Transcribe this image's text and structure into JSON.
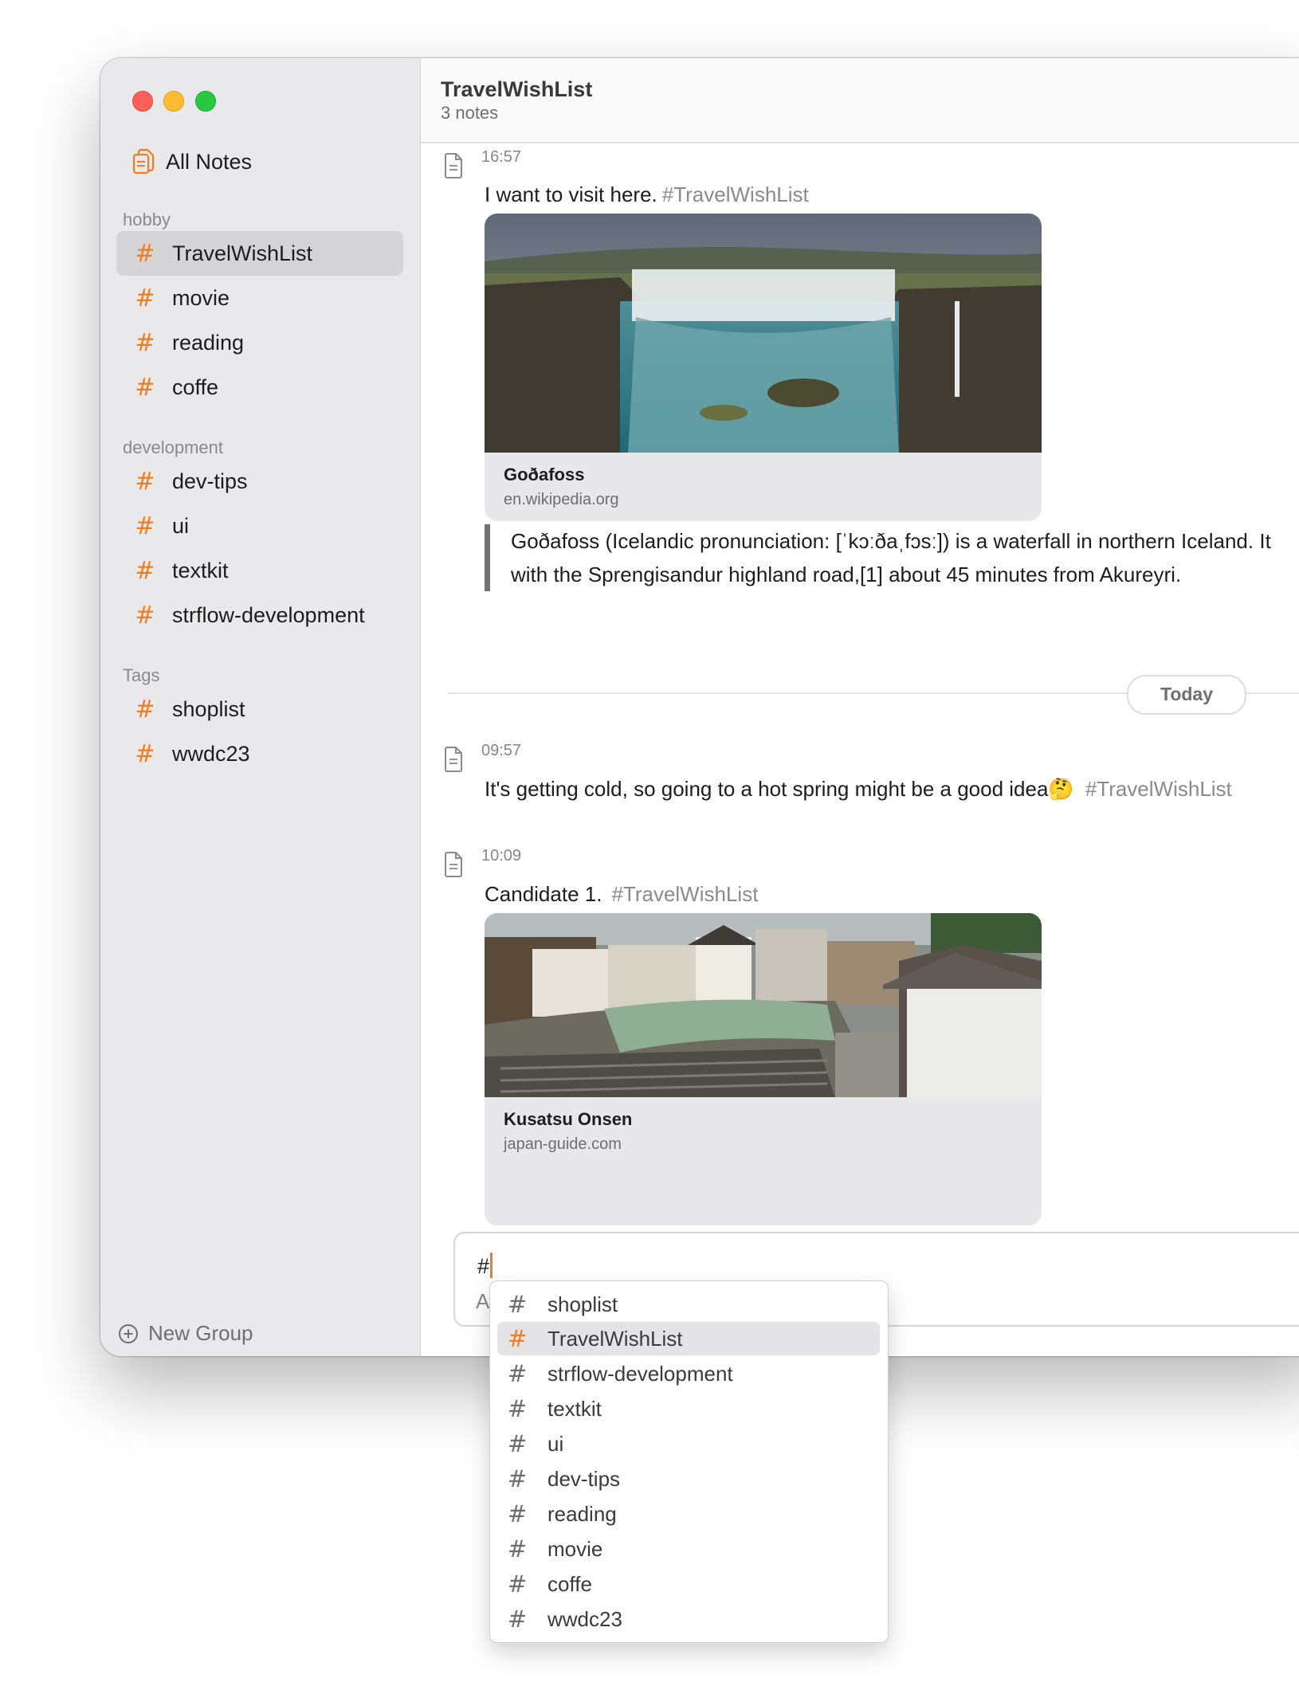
{
  "window": {
    "traffic_lights": [
      "close",
      "minimize",
      "zoom"
    ]
  },
  "sidebar": {
    "all_notes_label": "All Notes",
    "groups": [
      {
        "label": "hobby",
        "items": [
          "TravelWishList",
          "movie",
          "reading",
          "coffe"
        ]
      },
      {
        "label": "development",
        "items": [
          "dev-tips",
          "ui",
          "textkit",
          "strflow-development"
        ]
      },
      {
        "label": "Tags",
        "items": [
          "shoplist",
          "wwdc23"
        ]
      }
    ],
    "selected": "TravelWishList",
    "new_group_label": "New Group"
  },
  "header": {
    "title": "TravelWishList",
    "count": "3 notes"
  },
  "notes": [
    {
      "time": "16:57",
      "text": "I want to visit here.",
      "tag": "#TravelWishList",
      "link": {
        "title": "Goðafoss",
        "domain": "en.wikipedia.org"
      },
      "quote_lines": [
        "Goðafoss (Icelandic pronunciation: [ˈkɔːðaˌfɔsː]) is a waterfall in northern Iceland. It",
        "with the Sprengisandur highland road,[1] about 45 minutes from Akureyri."
      ]
    },
    {
      "time": "09:57",
      "text": "It's getting cold, so going to a hot spring might be a good idea🤔",
      "tag": "#TravelWishList"
    },
    {
      "time": "10:09",
      "text": "Candidate 1.",
      "tag": "#TravelWishList",
      "link": {
        "title": "Kusatsu Onsen",
        "domain": "japan-guide.com"
      }
    }
  ],
  "day_separator": "Today",
  "composer": {
    "typed": "#",
    "placeholder": "A"
  },
  "autocomplete": {
    "items": [
      "shoplist",
      "TravelWishList",
      "strflow-development",
      "textkit",
      "ui",
      "dev-tips",
      "reading",
      "movie",
      "coffe",
      "wwdc23"
    ],
    "highlighted": "TravelWishList"
  },
  "colors": {
    "accent": "#f07d1f",
    "sidebar_bg": "#e9e9eb",
    "selection": "#d5d5d8"
  },
  "icons": {
    "all_notes": "documents-icon",
    "note": "note-document-icon",
    "tag": "hash-icon",
    "new_group": "plus-circle-icon"
  }
}
